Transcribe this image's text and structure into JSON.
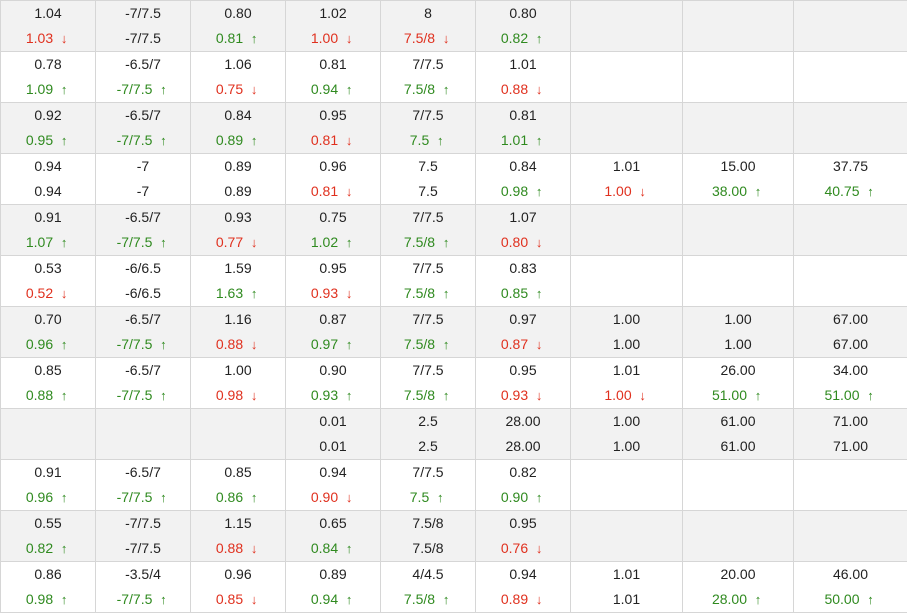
{
  "colors": {
    "up": "#2f8a1f",
    "down": "#e0301e",
    "neutral": "#222222",
    "row_alt_bg": "#f2f2f2"
  },
  "rows": [
    {
      "cells": [
        {
          "top": "1.04",
          "bot": "1.03",
          "dir": "down"
        },
        {
          "top": "-7/7.5",
          "bot": "-7/7.5",
          "dir": "none"
        },
        {
          "top": "0.80",
          "bot": "0.81",
          "dir": "up"
        },
        {
          "top": "1.02",
          "bot": "1.00",
          "dir": "down"
        },
        {
          "top": "8",
          "bot": "7.5/8",
          "dir": "down"
        },
        {
          "top": "0.80",
          "bot": "0.82",
          "dir": "up"
        },
        {
          "top": "",
          "bot": "",
          "dir": "none"
        },
        {
          "top": "",
          "bot": "",
          "dir": "none"
        },
        {
          "top": "",
          "bot": "",
          "dir": "none"
        }
      ]
    },
    {
      "cells": [
        {
          "top": "0.78",
          "bot": "1.09",
          "dir": "up"
        },
        {
          "top": "-6.5/7",
          "bot": "-7/7.5",
          "dir": "up"
        },
        {
          "top": "1.06",
          "bot": "0.75",
          "dir": "down"
        },
        {
          "top": "0.81",
          "bot": "0.94",
          "dir": "up"
        },
        {
          "top": "7/7.5",
          "bot": "7.5/8",
          "dir": "up"
        },
        {
          "top": "1.01",
          "bot": "0.88",
          "dir": "down"
        },
        {
          "top": "",
          "bot": "",
          "dir": "none"
        },
        {
          "top": "",
          "bot": "",
          "dir": "none"
        },
        {
          "top": "",
          "bot": "",
          "dir": "none"
        }
      ]
    },
    {
      "cells": [
        {
          "top": "0.92",
          "bot": "0.95",
          "dir": "up"
        },
        {
          "top": "-6.5/7",
          "bot": "-7/7.5",
          "dir": "up"
        },
        {
          "top": "0.84",
          "bot": "0.89",
          "dir": "up"
        },
        {
          "top": "0.95",
          "bot": "0.81",
          "dir": "down"
        },
        {
          "top": "7/7.5",
          "bot": "7.5",
          "dir": "up"
        },
        {
          "top": "0.81",
          "bot": "1.01",
          "dir": "up"
        },
        {
          "top": "",
          "bot": "",
          "dir": "none"
        },
        {
          "top": "",
          "bot": "",
          "dir": "none"
        },
        {
          "top": "",
          "bot": "",
          "dir": "none"
        }
      ]
    },
    {
      "cells": [
        {
          "top": "0.94",
          "bot": "0.94",
          "dir": "none"
        },
        {
          "top": "-7",
          "bot": "-7",
          "dir": "none"
        },
        {
          "top": "0.89",
          "bot": "0.89",
          "dir": "none"
        },
        {
          "top": "0.96",
          "bot": "0.81",
          "dir": "down"
        },
        {
          "top": "7.5",
          "bot": "7.5",
          "dir": "none"
        },
        {
          "top": "0.84",
          "bot": "0.98",
          "dir": "up"
        },
        {
          "top": "1.01",
          "bot": "1.00",
          "dir": "down"
        },
        {
          "top": "15.00",
          "bot": "38.00",
          "dir": "up"
        },
        {
          "top": "37.75",
          "bot": "40.75",
          "dir": "up"
        }
      ]
    },
    {
      "cells": [
        {
          "top": "0.91",
          "bot": "1.07",
          "dir": "up"
        },
        {
          "top": "-6.5/7",
          "bot": "-7/7.5",
          "dir": "up"
        },
        {
          "top": "0.93",
          "bot": "0.77",
          "dir": "down"
        },
        {
          "top": "0.75",
          "bot": "1.02",
          "dir": "up"
        },
        {
          "top": "7/7.5",
          "bot": "7.5/8",
          "dir": "up"
        },
        {
          "top": "1.07",
          "bot": "0.80",
          "dir": "down"
        },
        {
          "top": "",
          "bot": "",
          "dir": "none"
        },
        {
          "top": "",
          "bot": "",
          "dir": "none"
        },
        {
          "top": "",
          "bot": "",
          "dir": "none"
        }
      ]
    },
    {
      "cells": [
        {
          "top": "0.53",
          "bot": "0.52",
          "dir": "down"
        },
        {
          "top": "-6/6.5",
          "bot": "-6/6.5",
          "dir": "none"
        },
        {
          "top": "1.59",
          "bot": "1.63",
          "dir": "up"
        },
        {
          "top": "0.95",
          "bot": "0.93",
          "dir": "down"
        },
        {
          "top": "7/7.5",
          "bot": "7.5/8",
          "dir": "up"
        },
        {
          "top": "0.83",
          "bot": "0.85",
          "dir": "up"
        },
        {
          "top": "",
          "bot": "",
          "dir": "none"
        },
        {
          "top": "",
          "bot": "",
          "dir": "none"
        },
        {
          "top": "",
          "bot": "",
          "dir": "none"
        }
      ]
    },
    {
      "cells": [
        {
          "top": "0.70",
          "bot": "0.96",
          "dir": "up"
        },
        {
          "top": "-6.5/7",
          "bot": "-7/7.5",
          "dir": "up"
        },
        {
          "top": "1.16",
          "bot": "0.88",
          "dir": "down"
        },
        {
          "top": "0.87",
          "bot": "0.97",
          "dir": "up"
        },
        {
          "top": "7/7.5",
          "bot": "7.5/8",
          "dir": "up"
        },
        {
          "top": "0.97",
          "bot": "0.87",
          "dir": "down"
        },
        {
          "top": "1.00",
          "bot": "1.00",
          "dir": "none"
        },
        {
          "top": "1.00",
          "bot": "1.00",
          "dir": "none"
        },
        {
          "top": "67.00",
          "bot": "67.00",
          "dir": "none"
        }
      ]
    },
    {
      "cells": [
        {
          "top": "0.85",
          "bot": "0.88",
          "dir": "up"
        },
        {
          "top": "-6.5/7",
          "bot": "-7/7.5",
          "dir": "up"
        },
        {
          "top": "1.00",
          "bot": "0.98",
          "dir": "down"
        },
        {
          "top": "0.90",
          "bot": "0.93",
          "dir": "up"
        },
        {
          "top": "7/7.5",
          "bot": "7.5/8",
          "dir": "up"
        },
        {
          "top": "0.95",
          "bot": "0.93",
          "dir": "down"
        },
        {
          "top": "1.01",
          "bot": "1.00",
          "dir": "down"
        },
        {
          "top": "26.00",
          "bot": "51.00",
          "dir": "up"
        },
        {
          "top": "34.00",
          "bot": "51.00",
          "dir": "up"
        }
      ]
    },
    {
      "cells": [
        {
          "top": "",
          "bot": "",
          "dir": "none"
        },
        {
          "top": "",
          "bot": "",
          "dir": "none"
        },
        {
          "top": "",
          "bot": "",
          "dir": "none"
        },
        {
          "top": "0.01",
          "bot": "0.01",
          "dir": "none"
        },
        {
          "top": "2.5",
          "bot": "2.5",
          "dir": "none"
        },
        {
          "top": "28.00",
          "bot": "28.00",
          "dir": "none"
        },
        {
          "top": "1.00",
          "bot": "1.00",
          "dir": "none"
        },
        {
          "top": "61.00",
          "bot": "61.00",
          "dir": "none"
        },
        {
          "top": "71.00",
          "bot": "71.00",
          "dir": "none"
        }
      ]
    },
    {
      "cells": [
        {
          "top": "0.91",
          "bot": "0.96",
          "dir": "up"
        },
        {
          "top": "-6.5/7",
          "bot": "-7/7.5",
          "dir": "up"
        },
        {
          "top": "0.85",
          "bot": "0.86",
          "dir": "up"
        },
        {
          "top": "0.94",
          "bot": "0.90",
          "dir": "down"
        },
        {
          "top": "7/7.5",
          "bot": "7.5",
          "dir": "up"
        },
        {
          "top": "0.82",
          "bot": "0.90",
          "dir": "up"
        },
        {
          "top": "",
          "bot": "",
          "dir": "none"
        },
        {
          "top": "",
          "bot": "",
          "dir": "none"
        },
        {
          "top": "",
          "bot": "",
          "dir": "none"
        }
      ]
    },
    {
      "cells": [
        {
          "top": "0.55",
          "bot": "0.82",
          "dir": "up"
        },
        {
          "top": "-7/7.5",
          "bot": "-7/7.5",
          "dir": "none"
        },
        {
          "top": "1.15",
          "bot": "0.88",
          "dir": "down"
        },
        {
          "top": "0.65",
          "bot": "0.84",
          "dir": "up"
        },
        {
          "top": "7.5/8",
          "bot": "7.5/8",
          "dir": "none"
        },
        {
          "top": "0.95",
          "bot": "0.76",
          "dir": "down"
        },
        {
          "top": "",
          "bot": "",
          "dir": "none"
        },
        {
          "top": "",
          "bot": "",
          "dir": "none"
        },
        {
          "top": "",
          "bot": "",
          "dir": "none"
        }
      ]
    },
    {
      "cells": [
        {
          "top": "0.86",
          "bot": "0.98",
          "dir": "up"
        },
        {
          "top": "-3.5/4",
          "bot": "-7/7.5",
          "dir": "up"
        },
        {
          "top": "0.96",
          "bot": "0.85",
          "dir": "down"
        },
        {
          "top": "0.89",
          "bot": "0.94",
          "dir": "up"
        },
        {
          "top": "4/4.5",
          "bot": "7.5/8",
          "dir": "up"
        },
        {
          "top": "0.94",
          "bot": "0.89",
          "dir": "down"
        },
        {
          "top": "1.01",
          "bot": "1.01",
          "dir": "none"
        },
        {
          "top": "20.00",
          "bot": "28.00",
          "dir": "up"
        },
        {
          "top": "46.00",
          "bot": "50.00",
          "dir": "up"
        }
      ]
    }
  ]
}
